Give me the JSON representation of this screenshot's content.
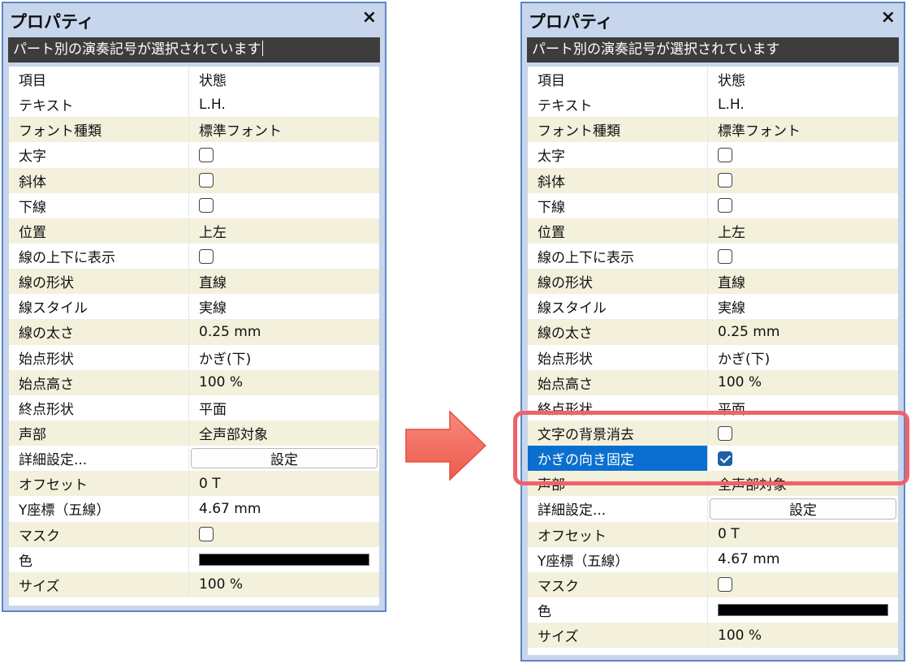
{
  "left_panel": {
    "title": "プロパティ",
    "close": "×",
    "status": "パート別の演奏記号が選択されています",
    "header": {
      "item": "項目",
      "state": "状態"
    },
    "rows": [
      {
        "label": "テキスト",
        "value": "L.H."
      },
      {
        "label": "フォント種類",
        "value": "標準フォント"
      },
      {
        "label": "太字",
        "checkbox": false
      },
      {
        "label": "斜体",
        "checkbox": false
      },
      {
        "label": "下線",
        "checkbox": false
      },
      {
        "label": "位置",
        "value": "上左"
      },
      {
        "label": "線の上下に表示",
        "checkbox": false
      },
      {
        "label": "線の形状",
        "value": "直線"
      },
      {
        "label": "線スタイル",
        "value": "実線"
      },
      {
        "label": "線の太さ",
        "value": "0.25 mm"
      },
      {
        "label": "始点形状",
        "value": "かぎ(下)"
      },
      {
        "label": "始点高さ",
        "value": "100 %"
      },
      {
        "label": "終点形状",
        "value": "平面"
      },
      {
        "label": "声部",
        "value": "全声部対象"
      },
      {
        "label": "詳細設定...",
        "button": "設定"
      },
      {
        "label": "オフセット",
        "value": "0 T"
      },
      {
        "label": "Y座標（五線）",
        "value": "4.67 mm"
      },
      {
        "label": "マスク",
        "checkbox": false
      },
      {
        "label": "色",
        "color": "#000000"
      },
      {
        "label": "サイズ",
        "value": "100 %"
      }
    ]
  },
  "right_panel": {
    "title": "プロパティ",
    "close": "×",
    "status": "パート別の演奏記号が選択されています",
    "header": {
      "item": "項目",
      "state": "状態"
    },
    "rows": [
      {
        "label": "テキスト",
        "value": "L.H."
      },
      {
        "label": "フォント種類",
        "value": "標準フォント"
      },
      {
        "label": "太字",
        "checkbox": false
      },
      {
        "label": "斜体",
        "checkbox": false
      },
      {
        "label": "下線",
        "checkbox": false
      },
      {
        "label": "位置",
        "value": "上左"
      },
      {
        "label": "線の上下に表示",
        "checkbox": false
      },
      {
        "label": "線の形状",
        "value": "直線"
      },
      {
        "label": "線スタイル",
        "value": "実線"
      },
      {
        "label": "線の太さ",
        "value": "0.25 mm"
      },
      {
        "label": "始点形状",
        "value": "かぎ(下)"
      },
      {
        "label": "始点高さ",
        "value": "100 %"
      },
      {
        "label": "終点形状",
        "value": "平面"
      },
      {
        "label": "文字の背景消去",
        "checkbox": false
      },
      {
        "label": "かぎの向き固定",
        "checkbox": true,
        "selected": true
      },
      {
        "label": "声部",
        "value": "全声部対象"
      },
      {
        "label": "詳細設定...",
        "button": "設定"
      },
      {
        "label": "オフセット",
        "value": "0 T"
      },
      {
        "label": "Y座標（五線）",
        "value": "4.67 mm"
      },
      {
        "label": "マスク",
        "checkbox": false
      },
      {
        "label": "色",
        "color": "#000000"
      },
      {
        "label": "サイズ",
        "value": "100 %"
      }
    ]
  },
  "colors": {
    "panel_border": "#5f86c6",
    "panel_bg": "#c7d6ec",
    "row_alt": "#f3f0dc",
    "selection": "#0b6fd0",
    "highlight": "#f06268",
    "arrow": "#f26d5f"
  },
  "icons": {
    "close": "close-icon",
    "arrow": "right-arrow-icon"
  }
}
